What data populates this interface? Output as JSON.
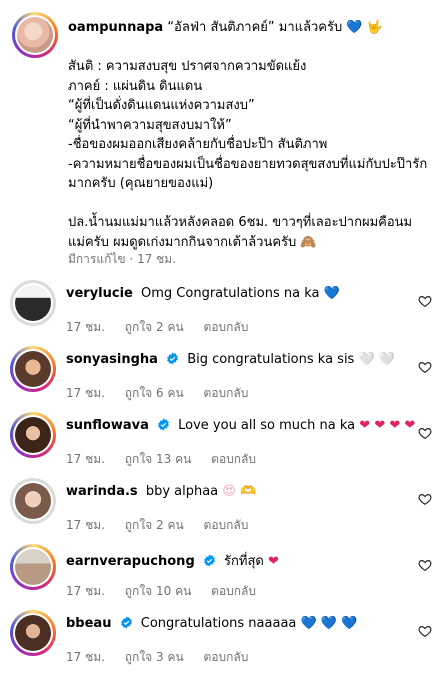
{
  "caption": {
    "username": "oampunnapa",
    "text": "“อัลฟ่า สันติภาคย์” มาแล้วครับ 💙 🤟\n\nสันติ : ความสงบสุข ปราศจากความขัดแย้ง\nภาคย์ : แผ่นดิน ดินแดน\n“ผู้ที่เป็นดั่งดินแดนแห่งความสงบ”\n“ผู้ที่นำพาความสุขสงบมาให้”\n-ชื่อของผมออกเสียงคล้ายกับชื่อปะป๊า สันติภาพ\n-ความหมายชื่อของผมเป็นชื่อของยายทวดสุขสงบที่แม่กับปะป๊ารักมากครับ (คุณยายของแม่)\n\nปล.น้ำนมแม่มาแล้วหลังคลอด 6ชม. ขาวๆที่เลอะปากผมคือนมแม่ครับ ผมดูดเก่งมากกินจากเต้าล้วนครับ 🙈",
    "edited": "มีการแก้ไข",
    "time": "17 ชม."
  },
  "comments": [
    {
      "username": "verylucie",
      "verified": false,
      "text": "Omg Congratulations na ka",
      "emoji": "💙",
      "time": "17 ชม.",
      "likes": "ถูกใจ 2 คน",
      "reply": "ตอบกลับ"
    },
    {
      "username": "sonyasingha",
      "verified": true,
      "text": "Big congratulations ka sis",
      "emoji": "🤍 🤍",
      "time": "17 ชม.",
      "likes": "ถูกใจ 6 คน",
      "reply": "ตอบกลับ"
    },
    {
      "username": "sunflowava",
      "verified": true,
      "text": "Love you all so much na ka",
      "emoji": "❤ ❤ ❤ ❤",
      "time": "17 ชม.",
      "likes": "ถูกใจ 13 คน",
      "reply": "ตอบกลับ"
    },
    {
      "username": "warinda.s",
      "verified": false,
      "text": "bby alphaa",
      "emoji": "😍 🫶",
      "time": "17 ชม.",
      "likes": "ถูกใจ 2 คน",
      "reply": "ตอบกลับ"
    },
    {
      "username": "earnverapuchong",
      "verified": true,
      "text": "รักที่สุด",
      "emoji": "❤",
      "time": "17 ชม.",
      "likes": "ถูกใจ 10 คน",
      "reply": "ตอบกลับ"
    },
    {
      "username": "bbeau",
      "verified": true,
      "text": "Congratulations naaaaa",
      "emoji": "💙 💙 💙",
      "time": "17 ชม.",
      "likes": "ถูกใจ 3 คน",
      "reply": "ตอบกลับ"
    }
  ],
  "colors": {
    "meta": "#737373",
    "verified": "#0095f6",
    "heart_blue": "#3f8be6",
    "heart_red": "#e0245e"
  },
  "icons": {
    "like": "heart-outline-icon",
    "verified": "verified-badge-icon"
  }
}
